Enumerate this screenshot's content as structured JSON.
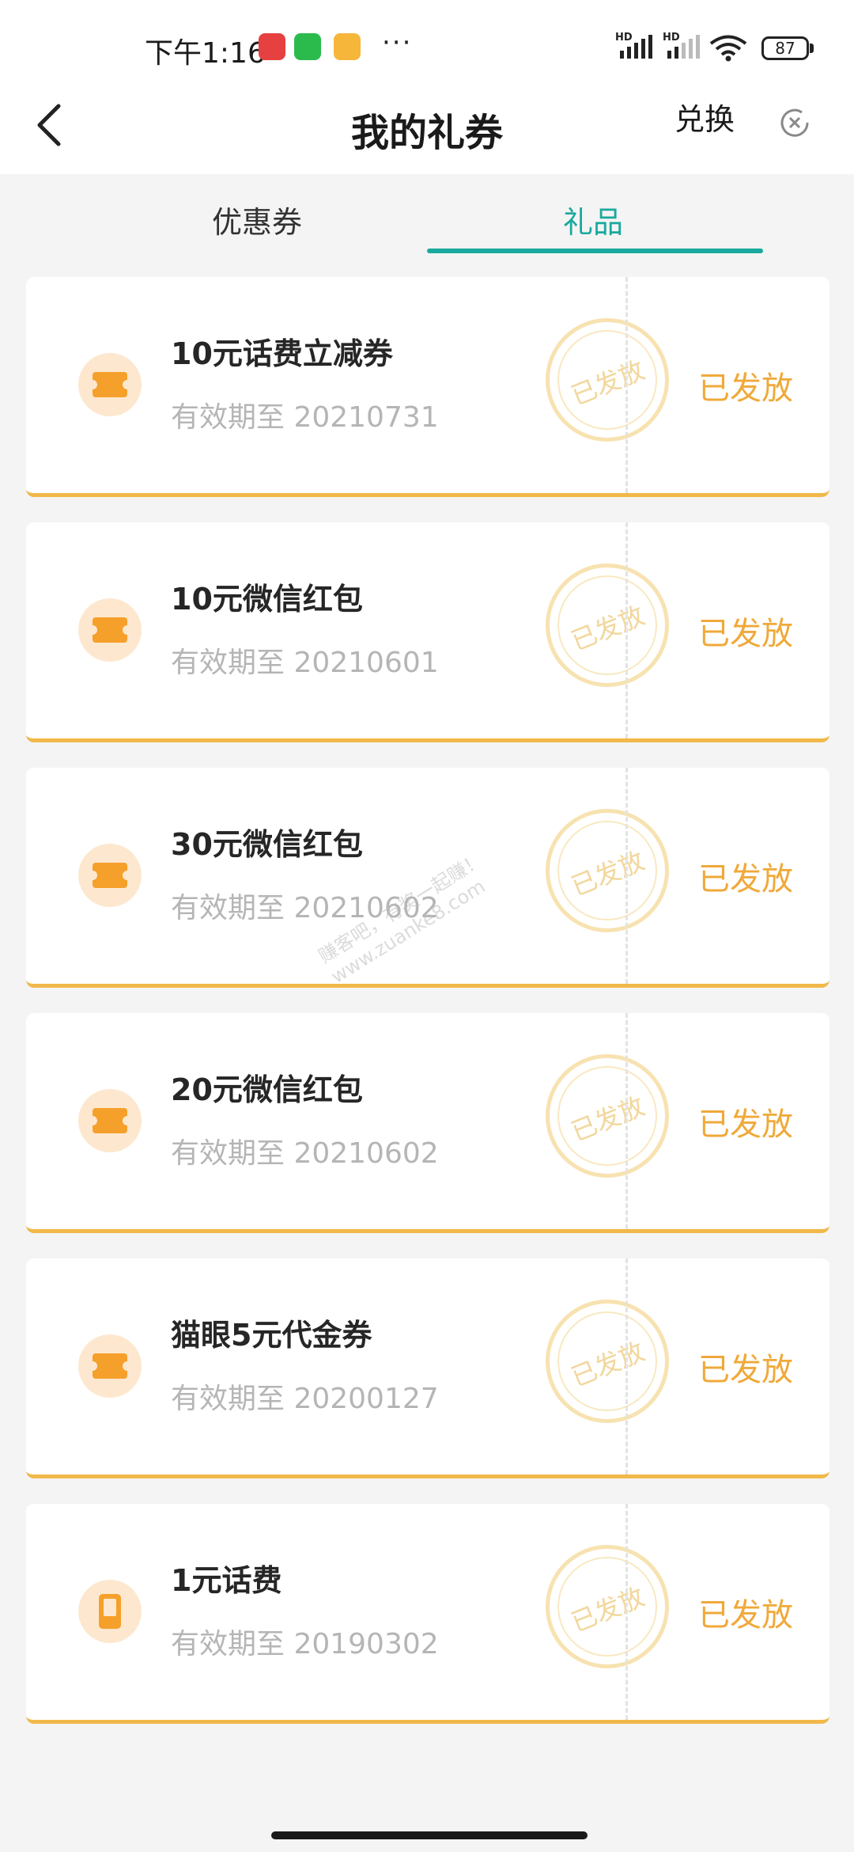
{
  "status_bar": {
    "time": "下午1:16",
    "battery": "87",
    "signal_label": "HD",
    "notifications": [
      "app-icon",
      "wechat-icon",
      "message-icon"
    ],
    "more": "···"
  },
  "header": {
    "title": "我的礼券",
    "redeem_label": "兑换"
  },
  "tabs": [
    {
      "label": "优惠券",
      "active": false
    },
    {
      "label": "礼品",
      "active": true
    }
  ],
  "gifts": [
    {
      "name": "10元话费立减券",
      "expiry": "有效期至 20210731",
      "stamp": "已发放",
      "status": "已发放",
      "icon": "ticket-icon"
    },
    {
      "name": "10元微信红包",
      "expiry": "有效期至 20210601",
      "stamp": "已发放",
      "status": "已发放",
      "icon": "ticket-icon"
    },
    {
      "name": "30元微信红包",
      "expiry": "有效期至 20210602",
      "stamp": "已发放",
      "status": "已发放",
      "icon": "ticket-icon"
    },
    {
      "name": "20元微信红包",
      "expiry": "有效期至 20210602",
      "stamp": "已发放",
      "status": "已发放",
      "icon": "ticket-icon"
    },
    {
      "name": "猫眼5元代金券",
      "expiry": "有效期至 20200127",
      "stamp": "已发放",
      "status": "已发放",
      "icon": "ticket-icon"
    },
    {
      "name": "1元话费",
      "expiry": "有效期至 20190302",
      "stamp": "已发放",
      "status": "已发放",
      "icon": "phone-icon"
    }
  ],
  "watermark": {
    "line1": "赚客吧，有奖一起赚！",
    "line2": "www.zuanke8.com"
  },
  "colors": {
    "accent": "#1aa99d",
    "gift_orange": "#f5a02a",
    "status_orange": "#f0a93a",
    "card_bottom": "#f1b84a"
  }
}
